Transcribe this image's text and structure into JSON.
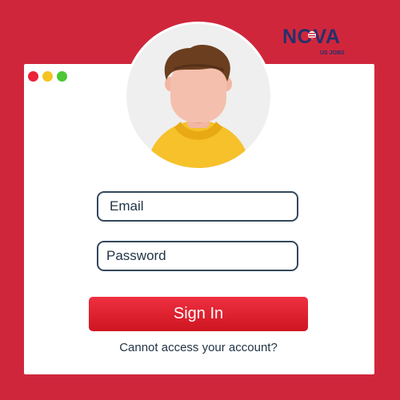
{
  "brand": {
    "name": "NOVA",
    "tagline": "US JOBS"
  },
  "window": {
    "controls": [
      "close-dot",
      "minimize-dot",
      "maximize-dot"
    ]
  },
  "form": {
    "email_placeholder": "Email",
    "password_placeholder": "Password",
    "signin_label": "Sign In",
    "forgot_link": "Cannot access your account?"
  },
  "colors": {
    "background": "#d0263c",
    "button": "#e42a36",
    "field_border": "#33475b",
    "brand_navy": "#23316c"
  },
  "icons": {
    "avatar": "user-avatar-illustration"
  }
}
